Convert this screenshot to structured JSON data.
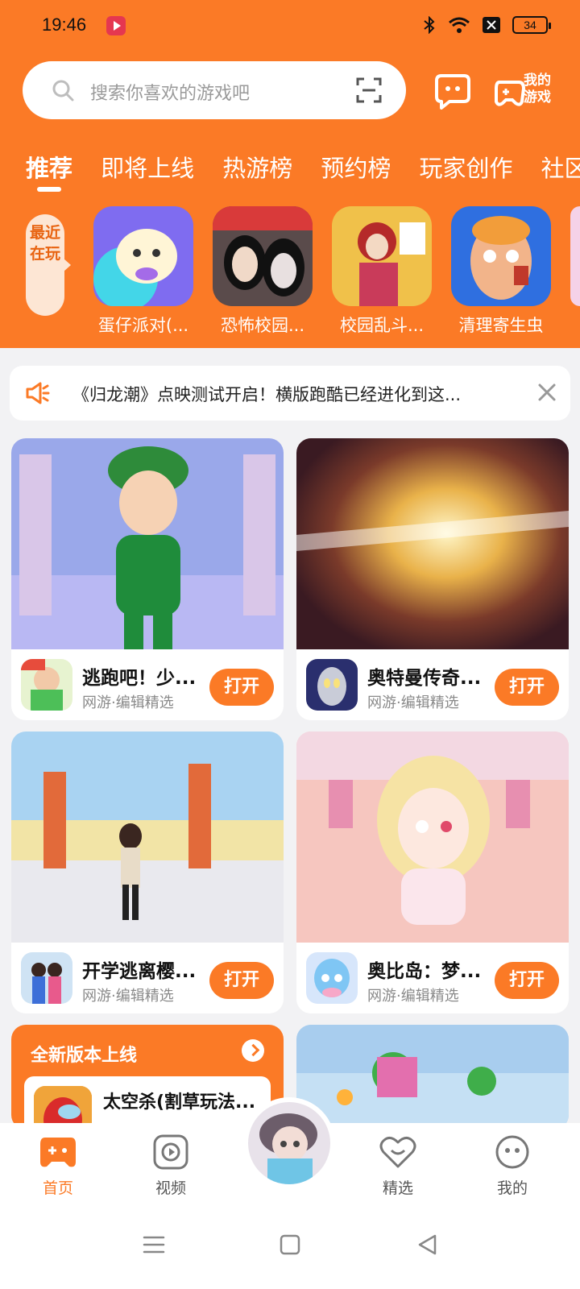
{
  "status_bar": {
    "time": "19:46",
    "battery": "34"
  },
  "search": {
    "placeholder": "搜索你喜欢的游戏吧"
  },
  "header": {
    "my_games_label": "我的游戏"
  },
  "tabs": [
    {
      "label": "推荐"
    },
    {
      "label": "即将上线"
    },
    {
      "label": "热游榜"
    },
    {
      "label": "预约榜"
    },
    {
      "label": "玩家创作"
    },
    {
      "label": "社区"
    }
  ],
  "recent": {
    "tag": "最近在玩",
    "items": [
      {
        "label": "蛋仔派对(..."
      },
      {
        "label": "恐怖校园..."
      },
      {
        "label": "校园乱斗..."
      },
      {
        "label": "清理寄生虫"
      }
    ]
  },
  "notice": {
    "text": "《归龙潮》点映测试开启！横版跑酷已经进化到这..."
  },
  "cards": [
    {
      "name": "逃跑吧！少...",
      "subtitle": "网游·编辑精选",
      "button": "打开"
    },
    {
      "name": "奥特曼传奇...",
      "subtitle": "网游·编辑精选",
      "button": "打开"
    },
    {
      "name": "开学逃离樱...",
      "subtitle": "网游·编辑精选",
      "button": "打开"
    },
    {
      "name": "奥比岛：梦...",
      "subtitle": "网游·编辑精选",
      "button": "打开"
    }
  ],
  "new_version": {
    "title": "全新版本上线",
    "game_name": "太空杀(割草玩法..."
  },
  "bottom_nav": [
    {
      "label": "首页"
    },
    {
      "label": "视频"
    },
    {
      "label": "精选"
    },
    {
      "label": "我的"
    }
  ],
  "colors": {
    "brand": "#fb7a26",
    "header": "#fb7a26",
    "background": "#f2f2f4"
  }
}
